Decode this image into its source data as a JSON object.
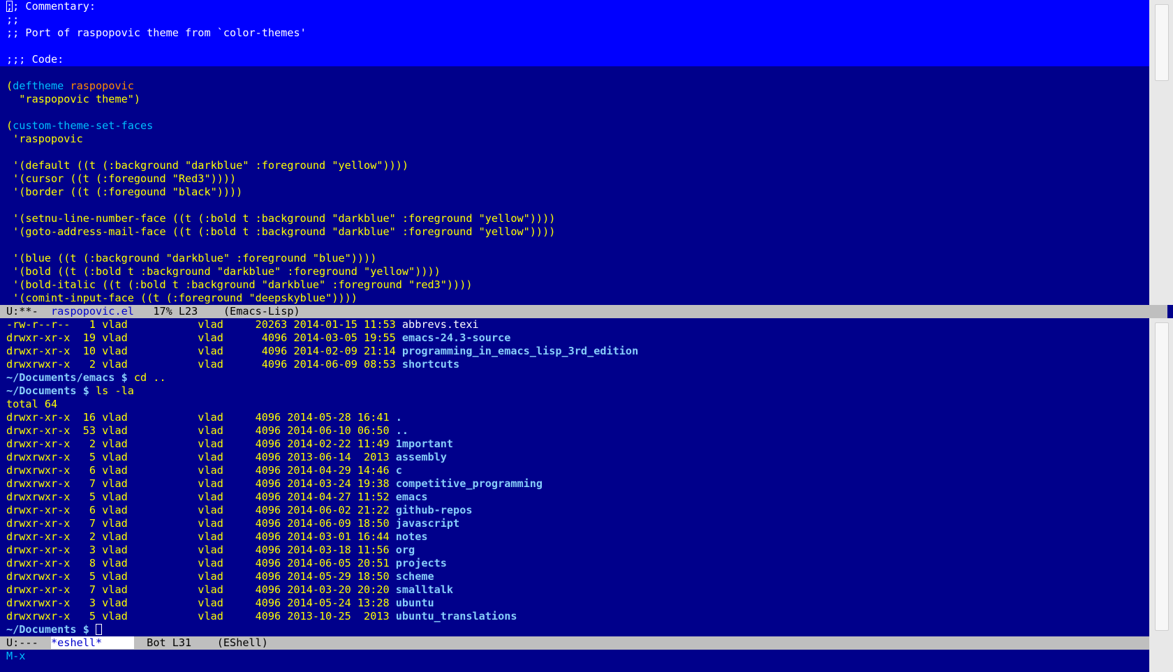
{
  "editor": {
    "comment_lines": [
      ";; Commentary:",
      ";;",
      ";; Port of raspopovic theme from `color-themes'",
      "",
      ";;; Code:"
    ],
    "deftheme_open": "(",
    "deftheme_kw": "deftheme",
    "deftheme_name": "raspopovic",
    "deftheme_doc": "  \"raspopovic theme\")",
    "set_faces_open": "(",
    "set_faces_kw": "custom-theme-set-faces",
    "theme_quote": " 'raspopovic",
    "face_lines": [
      " '(default ((t (:background \"darkblue\" :foreground \"yellow\"))))",
      " '(cursor ((t (:foregound \"Red3\"))))",
      " '(border ((t (:foregound \"black\"))))",
      "",
      " '(setnu-line-number-face ((t (:bold t :background \"darkblue\" :foreground \"yellow\"))))",
      " '(goto-address-mail-face ((t (:bold t :background \"darkblue\" :foreground \"yellow\"))))",
      "",
      " '(blue ((t (:background \"darkblue\" :foreground \"blue\"))))",
      " '(bold ((t (:bold t :background \"darkblue\" :foreground \"yellow\"))))",
      " '(bold-italic ((t (:bold t :background \"darkblue\" :foreground \"red3\"))))",
      " '(comint-input-face ((t (:foreground \"deepskyblue\"))))"
    ]
  },
  "editor_modeline": {
    "status": "U:**-  ",
    "buffer": "raspopovic.el",
    "position": "   17% L23    (Emacs-Lisp)"
  },
  "eshell": {
    "first_listing": [
      {
        "meta": "-rw-r--r--   1 vlad           vlad     20263 2014-01-15 11:53 ",
        "name": "abbrevs.texi",
        "dir": false
      },
      {
        "meta": "drwxr-xr-x  19 vlad           vlad      4096 2014-03-05 19:55 ",
        "name": "emacs-24.3-source",
        "dir": true
      },
      {
        "meta": "drwxr-xr-x  10 vlad           vlad      4096 2014-02-09 21:14 ",
        "name": "programming_in_emacs_lisp_3rd_edition",
        "dir": true
      },
      {
        "meta": "drwxrwxr-x   2 vlad           vlad      4096 2014-06-09 08:53 ",
        "name": "shortcuts",
        "dir": true
      }
    ],
    "prompt1_path": "~/Documents/emacs $",
    "prompt1_cmd": " cd ..",
    "prompt2_path": "~/Documents $",
    "prompt2_cmd": " ls -la",
    "total": "total 64",
    "second_listing": [
      {
        "meta": "drwxr-xr-x  16 vlad           vlad     4096 2014-05-28 16:41 ",
        "name": "."
      },
      {
        "meta": "drwxr-xr-x  53 vlad           vlad     4096 2014-06-10 06:50 ",
        "name": ".."
      },
      {
        "meta": "drwxr-xr-x   2 vlad           vlad     4096 2014-02-22 11:49 ",
        "name": "1mportant"
      },
      {
        "meta": "drwxrwxr-x   5 vlad           vlad     4096 2013-06-14  2013 ",
        "name": "assembly"
      },
      {
        "meta": "drwxrwxr-x   6 vlad           vlad     4096 2014-04-29 14:46 ",
        "name": "c"
      },
      {
        "meta": "drwxrwxr-x   7 vlad           vlad     4096 2014-03-24 19:38 ",
        "name": "competitive_programming"
      },
      {
        "meta": "drwxrwxr-x   5 vlad           vlad     4096 2014-04-27 11:52 ",
        "name": "emacs"
      },
      {
        "meta": "drwxr-xr-x   6 vlad           vlad     4096 2014-06-02 21:22 ",
        "name": "github-repos"
      },
      {
        "meta": "drwxr-xr-x   7 vlad           vlad     4096 2014-06-09 18:50 ",
        "name": "javascript"
      },
      {
        "meta": "drwxr-xr-x   2 vlad           vlad     4096 2014-03-01 16:44 ",
        "name": "notes"
      },
      {
        "meta": "drwxr-xr-x   3 vlad           vlad     4096 2014-03-18 11:56 ",
        "name": "org"
      },
      {
        "meta": "drwxr-xr-x   8 vlad           vlad     4096 2014-06-05 20:51 ",
        "name": "projects"
      },
      {
        "meta": "drwxrwxr-x   5 vlad           vlad     4096 2014-05-29 18:50 ",
        "name": "scheme"
      },
      {
        "meta": "drwxr-xr-x   7 vlad           vlad     4096 2014-03-20 20:20 ",
        "name": "smalltalk"
      },
      {
        "meta": "drwxrwxr-x   3 vlad           vlad     4096 2014-05-24 13:28 ",
        "name": "ubuntu"
      },
      {
        "meta": "drwxrwxr-x   5 vlad           vlad     4096 2013-10-25  2013 ",
        "name": "ubuntu_translations"
      }
    ],
    "prompt3_path": "~/Documents $",
    "prompt3_cmd": " "
  },
  "eshell_modeline": {
    "status": "U:---  ",
    "buffer": "*eshell*     ",
    "position": "  Bot L31    (EShell)"
  },
  "minibuffer": {
    "text": "M-x"
  },
  "colors": {
    "background": "#00008b",
    "foreground": "#ffff00",
    "region_highlight": "#0000ff",
    "keyword": "#00bfff",
    "theme_name": "#ff8c00",
    "directory": "#87cefa",
    "modeline": "#bfbfbf"
  }
}
